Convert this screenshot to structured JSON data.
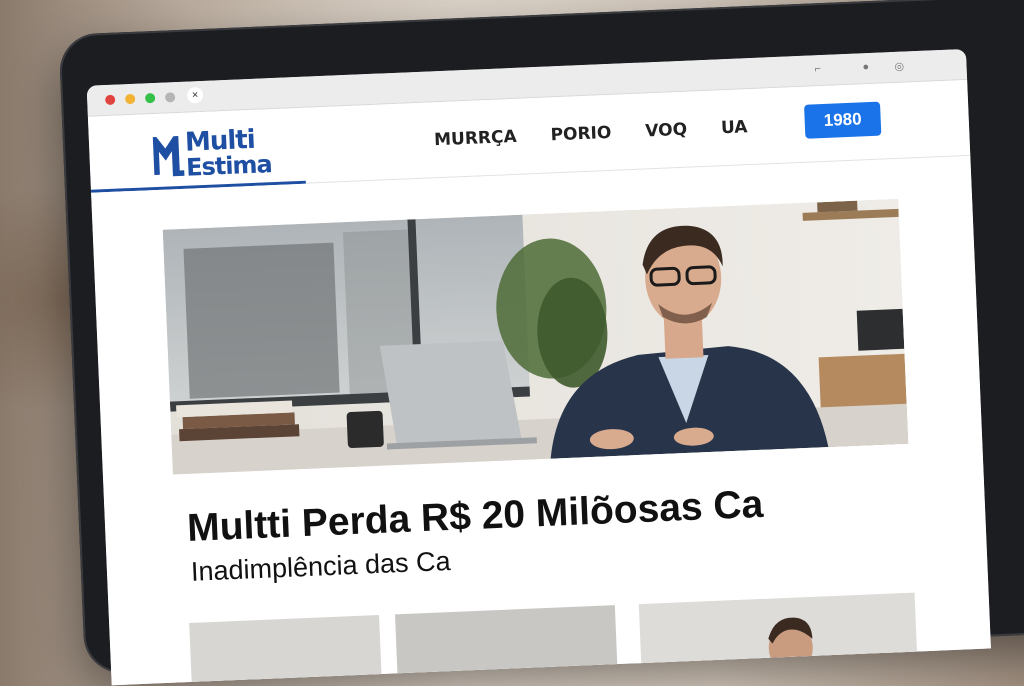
{
  "window": {
    "close_symbol": "×",
    "controls": [
      "traffic-light-red",
      "traffic-light-yellow",
      "traffic-light-green",
      "traffic-light-gray"
    ]
  },
  "site": {
    "logo_line1": "Multi",
    "logo_line2": "Estima"
  },
  "nav": {
    "items": [
      "MURRÇA",
      "PORIO",
      "VOQ",
      "UA"
    ],
    "button_label": "1980"
  },
  "article": {
    "headline": "Multti Perda R$ 20 Milõosas Ca",
    "subheadline": "Inadimplência das Ca"
  },
  "colors": {
    "brand": "#1e4fa3",
    "button": "#1a73e8"
  }
}
